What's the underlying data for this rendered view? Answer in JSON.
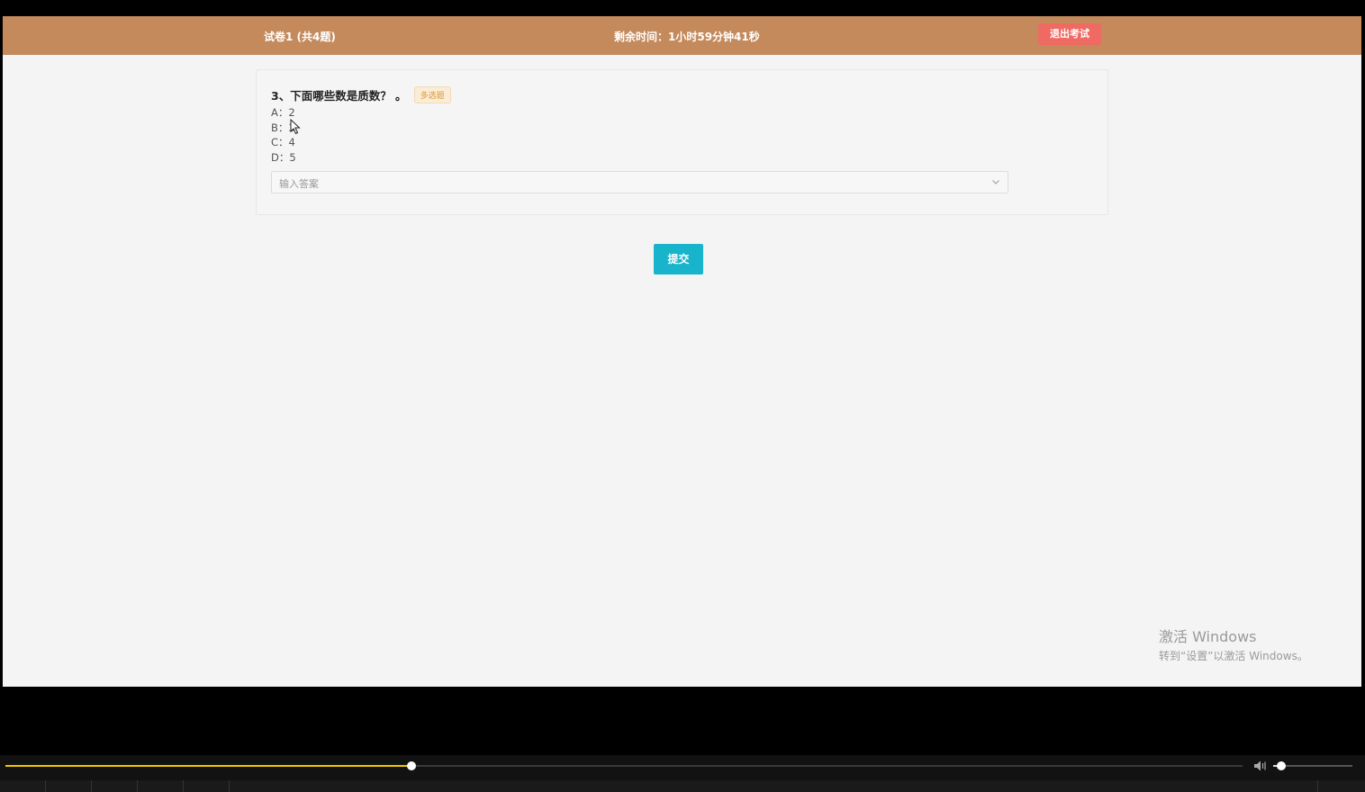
{
  "header": {
    "paper_title": "试卷1 (共4题)",
    "timer": "剩余时间：1小时59分钟41秒",
    "exit_label": "退出考试"
  },
  "question": {
    "text": "3、下面哪些数是质数？ 。",
    "tag": "多选题",
    "options": [
      "A：2",
      "B：3",
      "C：4",
      "D：5"
    ],
    "answer_placeholder": "输入答案"
  },
  "submit_label": "提交",
  "watermark": {
    "line1": "激活 Windows",
    "line2": "转到“设置”以激活 Windows。"
  },
  "player": {
    "progress": 0.328,
    "volume": 0.1
  },
  "colors": {
    "header_bg": "#c48a5c",
    "exit_button": "#ee6a63",
    "submit_button": "#17b4cc",
    "seek_fill": "#f0c800"
  }
}
